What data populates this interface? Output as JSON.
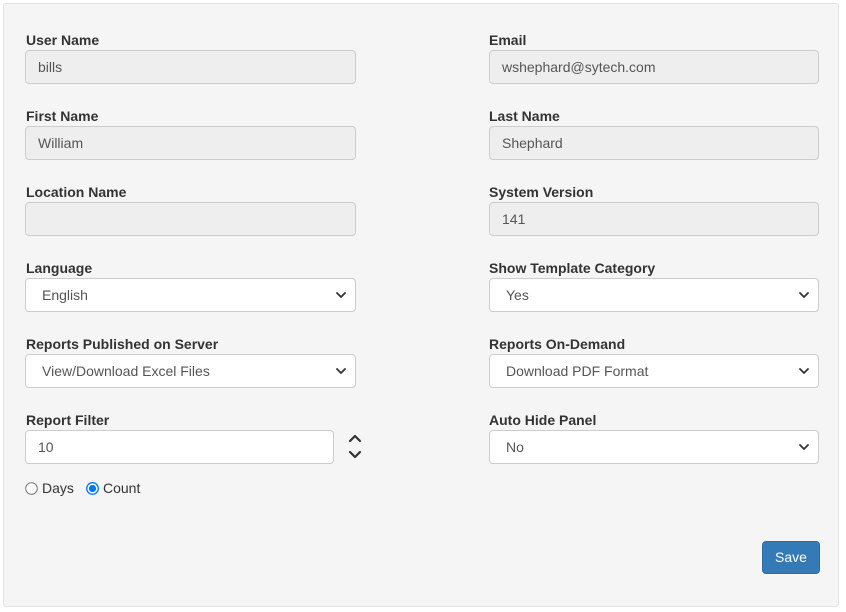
{
  "form": {
    "user_name": {
      "label": "User Name",
      "value": "bills"
    },
    "email": {
      "label": "Email",
      "value": "wshephard@sytech.com"
    },
    "first_name": {
      "label": "First Name",
      "value": "William"
    },
    "last_name": {
      "label": "Last Name",
      "value": "Shephard"
    },
    "location_name": {
      "label": "Location Name",
      "value": ""
    },
    "system_version": {
      "label": "System Version",
      "value": "141"
    },
    "language": {
      "label": "Language",
      "selected": "English"
    },
    "show_template_category": {
      "label": "Show Template Category",
      "selected": "Yes"
    },
    "reports_published": {
      "label": "Reports Published on Server",
      "selected": "View/Download Excel Files"
    },
    "reports_on_demand": {
      "label": "Reports On-Demand",
      "selected": "Download PDF Format"
    },
    "report_filter": {
      "label": "Report Filter",
      "value": "10",
      "options": [
        {
          "label": "Days",
          "checked": false
        },
        {
          "label": "Count",
          "checked": true
        }
      ]
    },
    "auto_hide_panel": {
      "label": "Auto Hide Panel",
      "selected": "No"
    }
  },
  "actions": {
    "save_label": "Save"
  },
  "colors": {
    "panel_bg": "#f5f5f5",
    "readonly_bg": "#eeeeee",
    "primary": "#337ab7",
    "text": "#333333",
    "input_text": "#555555"
  },
  "icons": {
    "select_arrow": "chevron-down-icon",
    "spin_up": "chevron-up-icon",
    "spin_down": "chevron-down-icon"
  }
}
